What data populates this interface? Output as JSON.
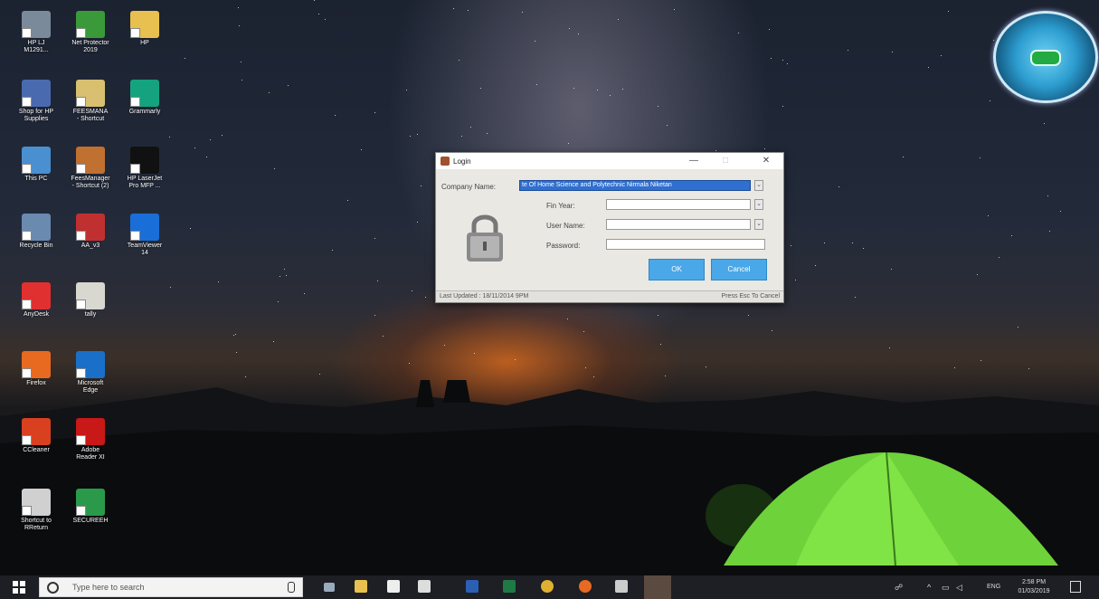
{
  "desktop": {
    "icons": [
      {
        "label": "HP LJ\nM1291...",
        "icon": "printer-icon",
        "color": "#7a8a9a"
      },
      {
        "label": "Net Protector\n2019",
        "icon": "shield-icon",
        "color": "#3a9a3a"
      },
      {
        "label": "HP",
        "icon": "folder-icon",
        "color": "#e8c050"
      },
      {
        "label": "Shop for HP\nSupplies",
        "icon": "cart-icon",
        "color": "#4a6ab0"
      },
      {
        "label": "FEESMANA\n- Shortcut",
        "icon": "document-icon",
        "color": "#d8c070"
      },
      {
        "label": "Grammarly",
        "icon": "grammarly-icon",
        "color": "#15a37f"
      },
      {
        "label": "This PC",
        "icon": "computer-icon",
        "color": "#4a90d0"
      },
      {
        "label": "FeesManager\n- Shortcut (2)",
        "icon": "person-icon",
        "color": "#c07030"
      },
      {
        "label": "HP LaserJet\nPro MFP ...",
        "icon": "hp-logo-icon",
        "color": "#111111"
      },
      {
        "label": "Recycle Bin",
        "icon": "recycle-bin-icon",
        "color": "#6a8ab0"
      },
      {
        "label": "AA_v3",
        "icon": "ammyy-icon",
        "color": "#c03030"
      },
      {
        "label": "TeamViewer\n14",
        "icon": "teamviewer-icon",
        "color": "#1a6ed8"
      },
      {
        "label": "AnyDesk",
        "icon": "anydesk-icon",
        "color": "#e03030"
      },
      {
        "label": "tally",
        "icon": "tally-icon",
        "color": "#d8d8d0"
      },
      {
        "label": "Firefox",
        "icon": "firefox-icon",
        "color": "#e86a20"
      },
      {
        "label": "Microsoft\nEdge",
        "icon": "edge-icon",
        "color": "#1a70c8"
      },
      {
        "label": "CCleaner",
        "icon": "ccleaner-icon",
        "color": "#d84020"
      },
      {
        "label": "Adobe\nReader XI",
        "icon": "adobe-reader-icon",
        "color": "#c81818"
      },
      {
        "label": "Shortcut to\nRReturn",
        "icon": "rreturn-icon",
        "color": "#d0d0d0"
      },
      {
        "label": "SECUREEH",
        "icon": "secure-icon",
        "color": "#2a9a4a"
      }
    ]
  },
  "dialog": {
    "title": "Login",
    "company_label": "Company Name:",
    "company_value": "te Of Home Science and Polytechnic Nirmala Niketan",
    "fin_year_label": "Fin Year:",
    "fin_year_value": "",
    "user_name_label": "User Name:",
    "user_name_value": "",
    "password_label": "Password:",
    "password_value": "",
    "ok_label": "OK",
    "cancel_label": "Cancel",
    "status_left": "Last Updated : 18/11/2014  9PM",
    "status_right": "Press Esc To Cancel",
    "minimize": "—",
    "maximize": "□",
    "close": "✕"
  },
  "taskbar": {
    "search_placeholder": "Type here to search",
    "tray_lang": "ENG",
    "time": "2:58 PM",
    "date": "01/03/2019"
  }
}
